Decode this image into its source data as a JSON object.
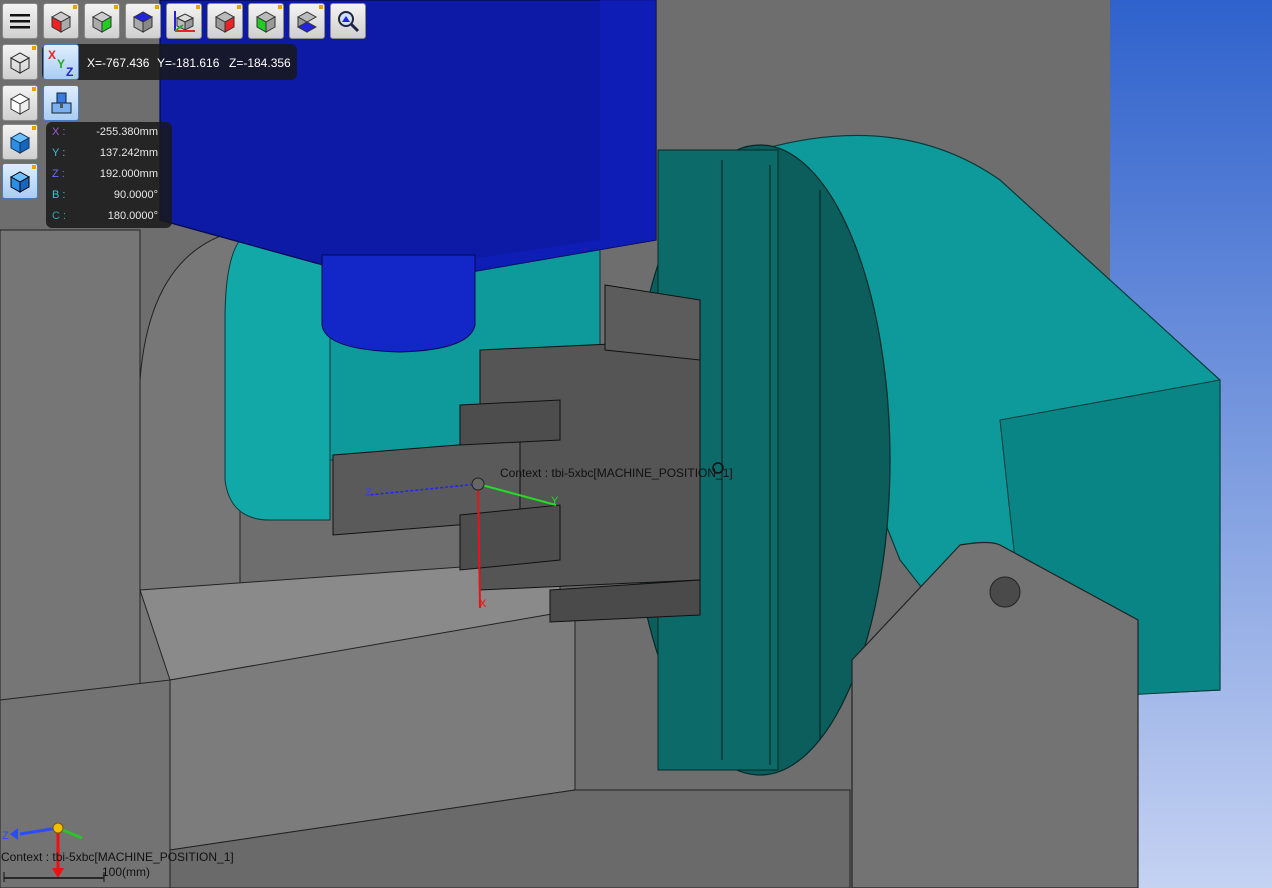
{
  "toolbar": {
    "menu_icon": "hamburger-menu-icon",
    "buttons": [
      {
        "name": "view-front-button",
        "icon": "cube-front-red-icon"
      },
      {
        "name": "view-side-button",
        "icon": "cube-side-green-icon"
      },
      {
        "name": "view-top-button",
        "icon": "cube-top-blue-icon"
      },
      {
        "name": "view-iso-axes-button",
        "icon": "cube-axes-icon"
      },
      {
        "name": "view-back-button",
        "icon": "cube-back-red-icon"
      },
      {
        "name": "view-right-button",
        "icon": "cube-right-green-icon"
      },
      {
        "name": "view-bottom-button",
        "icon": "cube-bottom-blue-icon"
      },
      {
        "name": "zoom-fit-button",
        "icon": "magnifier-icon"
      }
    ]
  },
  "cursor_coords": {
    "x": "X=-767.436",
    "y": "Y=-181.616",
    "z": "Z=-184.356"
  },
  "machine_position": {
    "rows": [
      {
        "label": "X :",
        "value": "-255.380mm",
        "color": "#9b59d0"
      },
      {
        "label": "Y :",
        "value": "137.242mm",
        "color": "#3cc3d8"
      },
      {
        "label": "Z :",
        "value": "192.000mm",
        "color": "#6a6aff"
      },
      {
        "label": "B :",
        "value": "90.0000°",
        "color": "#3cc3d8"
      },
      {
        "label": "C :",
        "value": "180.0000°",
        "color": "#2aa6a6"
      }
    ]
  },
  "viewport": {
    "context_label": "Context : tbi-5xbc[MACHINE_POSITION_1]",
    "bottom_context_label": "Context : tbi-5xbc[MACHINE_POSITION_1]",
    "scale_label": "100(mm)",
    "work_axes": {
      "x": "X",
      "y": "Y",
      "z": "Z"
    },
    "triad_axes": {
      "z": "Z"
    }
  },
  "colors": {
    "spindle_blue": "#0c1aa6",
    "table_teal": "#0e9a9a",
    "table_dark_teal": "#0b5e5c",
    "machine_gray": "#6e6e6e",
    "part_gray": "#555555",
    "background_blue": "#3a6fd0"
  }
}
